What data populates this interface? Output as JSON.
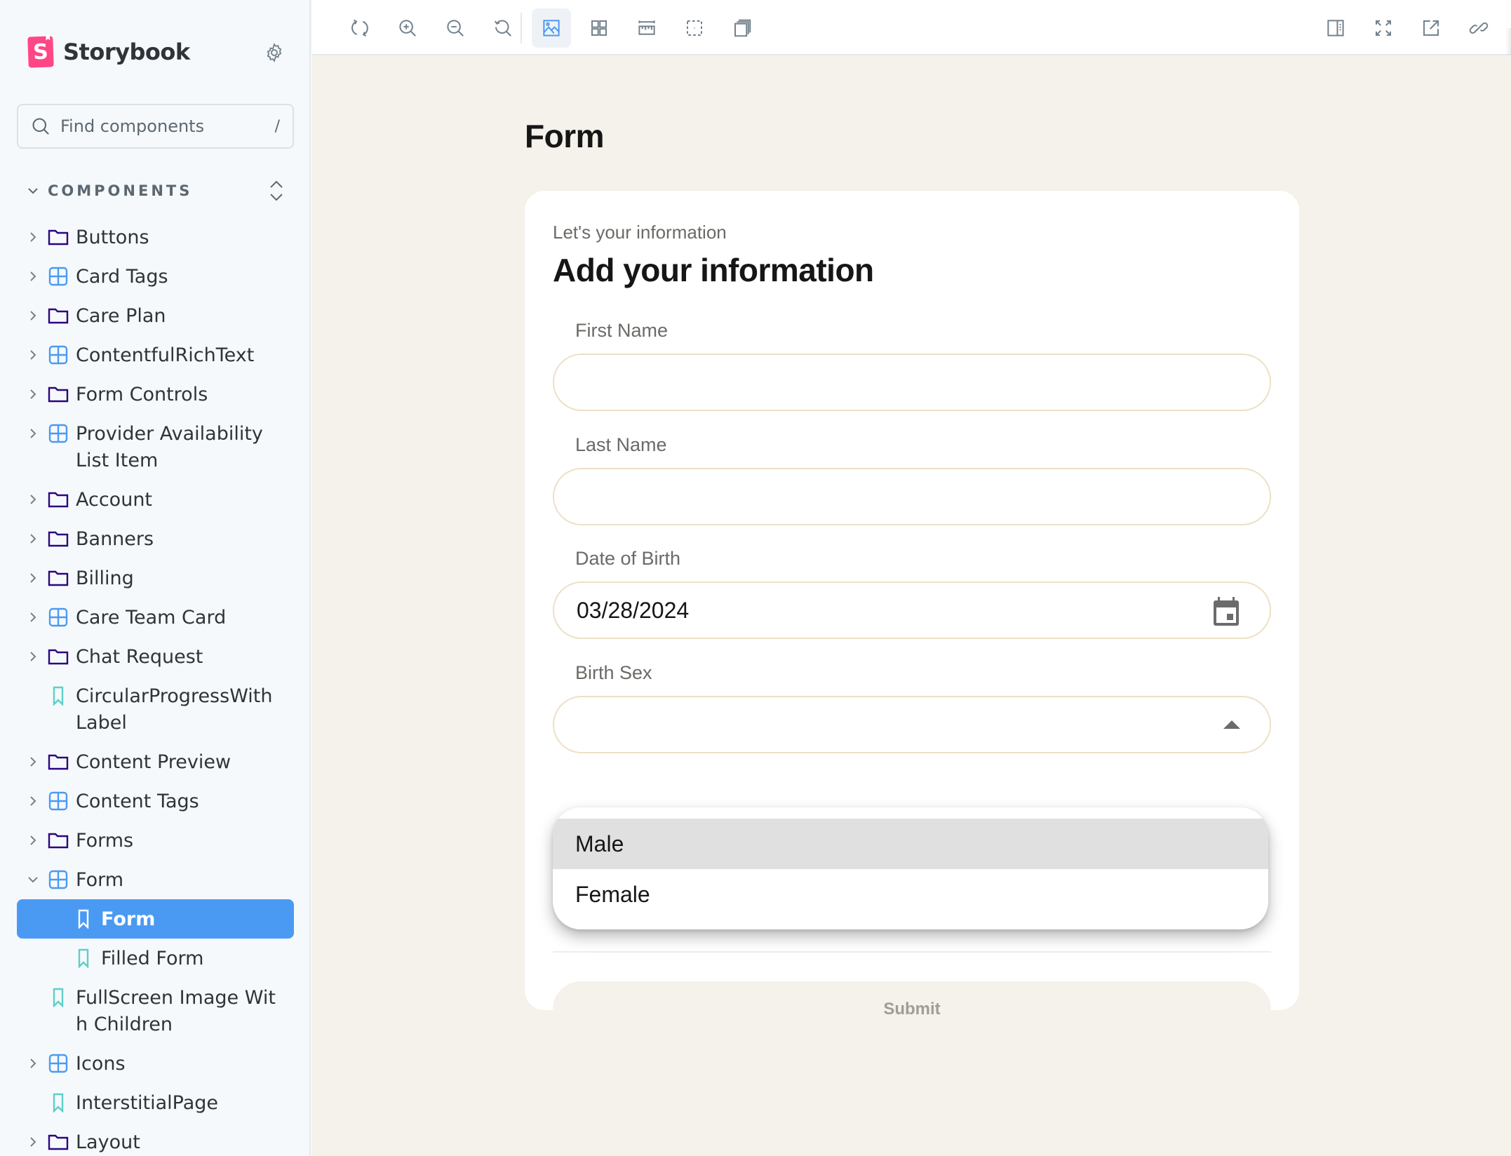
{
  "sidebar": {
    "brand": {
      "logo_letter": "S",
      "name": "Storybook"
    },
    "search": {
      "placeholder": "Find components",
      "shortcut": "/"
    },
    "section": {
      "label": "COMPONENTS"
    },
    "items": [
      {
        "label": "Buttons",
        "type": "folder",
        "expandable": true,
        "expanded": false,
        "depth": 1
      },
      {
        "label": "Card Tags",
        "type": "component",
        "expandable": true,
        "expanded": false,
        "depth": 1
      },
      {
        "label": "Care Plan",
        "type": "folder",
        "expandable": true,
        "expanded": false,
        "depth": 1
      },
      {
        "label": "ContentfulRichText",
        "type": "component",
        "expandable": true,
        "expanded": false,
        "depth": 1
      },
      {
        "label": "Form Controls",
        "type": "folder",
        "expandable": true,
        "expanded": false,
        "depth": 1
      },
      {
        "label": "Provider Availability List Item",
        "type": "component",
        "expandable": true,
        "expanded": false,
        "depth": 1
      },
      {
        "label": "Account",
        "type": "folder",
        "expandable": true,
        "expanded": false,
        "depth": 1
      },
      {
        "label": "Banners",
        "type": "folder",
        "expandable": true,
        "expanded": false,
        "depth": 1
      },
      {
        "label": "Billing",
        "type": "folder",
        "expandable": true,
        "expanded": false,
        "depth": 1
      },
      {
        "label": "Care Team Card",
        "type": "component",
        "expandable": true,
        "expanded": false,
        "depth": 1
      },
      {
        "label": "Chat Request",
        "type": "folder",
        "expandable": true,
        "expanded": false,
        "depth": 1
      },
      {
        "label": "CircularProgressWithLabel",
        "type": "story",
        "expandable": false,
        "depth": 1
      },
      {
        "label": "Content Preview",
        "type": "folder",
        "expandable": true,
        "expanded": false,
        "depth": 1
      },
      {
        "label": "Content Tags",
        "type": "component",
        "expandable": true,
        "expanded": false,
        "depth": 1
      },
      {
        "label": "Forms",
        "type": "folder",
        "expandable": true,
        "expanded": false,
        "depth": 1
      },
      {
        "label": "Form",
        "type": "component",
        "expandable": true,
        "expanded": true,
        "depth": 1
      },
      {
        "label": "Form",
        "type": "story",
        "expandable": false,
        "depth": 2,
        "selected": true
      },
      {
        "label": "Filled Form",
        "type": "story",
        "expandable": false,
        "depth": 2
      },
      {
        "label": "FullScreen Image With Children",
        "type": "story",
        "expandable": false,
        "depth": 1
      },
      {
        "label": "Icons",
        "type": "component",
        "expandable": true,
        "expanded": false,
        "depth": 1
      },
      {
        "label": "InterstitialPage",
        "type": "story",
        "expandable": false,
        "depth": 1
      },
      {
        "label": "Layout",
        "type": "folder",
        "expandable": true,
        "expanded": false,
        "depth": 1
      }
    ]
  },
  "toolbar": {
    "left_tools": [
      {
        "name": "remount-icon",
        "title": "Remount component"
      },
      {
        "name": "zoom-in-icon",
        "title": "Zoom in"
      },
      {
        "name": "zoom-out-icon",
        "title": "Zoom out"
      },
      {
        "name": "zoom-reset-icon",
        "title": "Reset zoom"
      },
      {
        "name": "background-icon",
        "title": "Change background",
        "active": true
      },
      {
        "name": "grid-icon",
        "title": "Apply grid"
      },
      {
        "name": "measure-icon",
        "title": "Measure"
      },
      {
        "name": "outline-icon",
        "title": "Outline"
      },
      {
        "name": "viewport-icon",
        "title": "Change viewport"
      }
    ],
    "right_tools": [
      {
        "name": "addons-panel-icon",
        "title": "Show addons"
      },
      {
        "name": "fullscreen-icon",
        "title": "Go full screen"
      },
      {
        "name": "open-new-tab-icon",
        "title": "Open in new tab"
      },
      {
        "name": "copy-link-icon",
        "title": "Copy link"
      }
    ]
  },
  "canvas": {
    "page_title": "Form",
    "card": {
      "subtitle": "Let's your information",
      "heading": "Add your information",
      "fields": {
        "first_name": {
          "label": "First Name",
          "value": ""
        },
        "last_name": {
          "label": "Last Name",
          "value": ""
        },
        "dob": {
          "label": "Date of Birth",
          "value": "03/28/2024"
        },
        "birth_sex": {
          "label": "Birth Sex",
          "value": "",
          "open": true,
          "options": [
            "Male",
            "Female"
          ],
          "highlighted": "Male"
        }
      },
      "submit_label": "Submit"
    }
  },
  "colors": {
    "accent": "#4a9af3",
    "folder_icon": "#2a0481",
    "component_icon": "#4a9af3",
    "story_icon": "#5ecfc8",
    "brand_pink": "#ff4785",
    "canvas_bg": "#f5f1eb",
    "field_border": "#ede0c6"
  }
}
